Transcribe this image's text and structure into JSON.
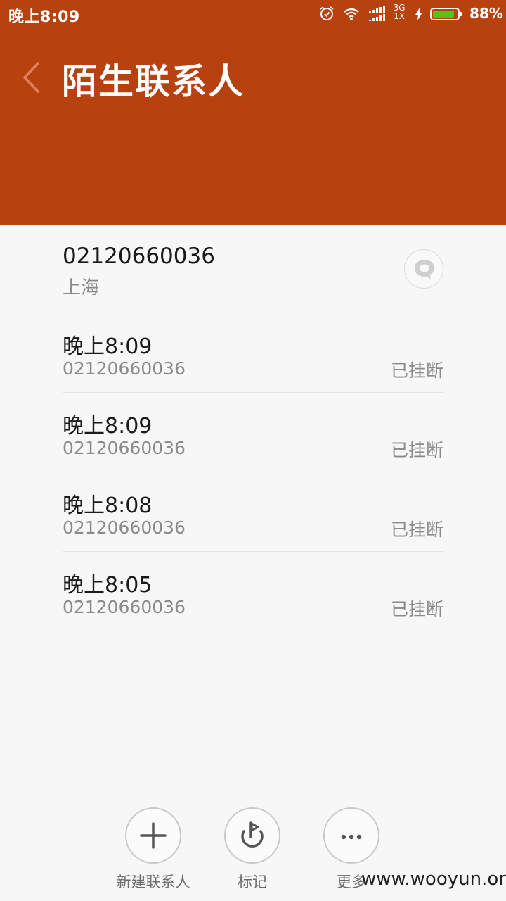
{
  "status_bar": {
    "time": "晚上8:09",
    "network_top": "3G",
    "network_bottom": "1X",
    "battery_percent": "88%",
    "battery_color": "#52c41a",
    "icons": [
      "alarm-icon",
      "wifi-icon",
      "signal-icon",
      "charging-icon",
      "battery-icon"
    ]
  },
  "header": {
    "title": "陌生联系人",
    "back_icon": "chevron-left-icon",
    "background": "#b84110"
  },
  "contact": {
    "number": "02120660036",
    "location": "上海",
    "message_icon": "message-bubble-icon"
  },
  "calls": [
    {
      "time": "晚上8:09",
      "number": "02120660036",
      "status": "已挂断"
    },
    {
      "time": "晚上8:09",
      "number": "02120660036",
      "status": "已挂断"
    },
    {
      "time": "晚上8:08",
      "number": "02120660036",
      "status": "已挂断"
    },
    {
      "time": "晚上8:05",
      "number": "02120660036",
      "status": "已挂断"
    }
  ],
  "actions": {
    "new_contact": {
      "label": "新建联系人",
      "icon": "plus-icon"
    },
    "mark": {
      "label": "标记",
      "icon": "flag-icon"
    },
    "more": {
      "label": "更多",
      "icon": "more-dots-icon"
    }
  },
  "watermark": "www.wooyun.org"
}
